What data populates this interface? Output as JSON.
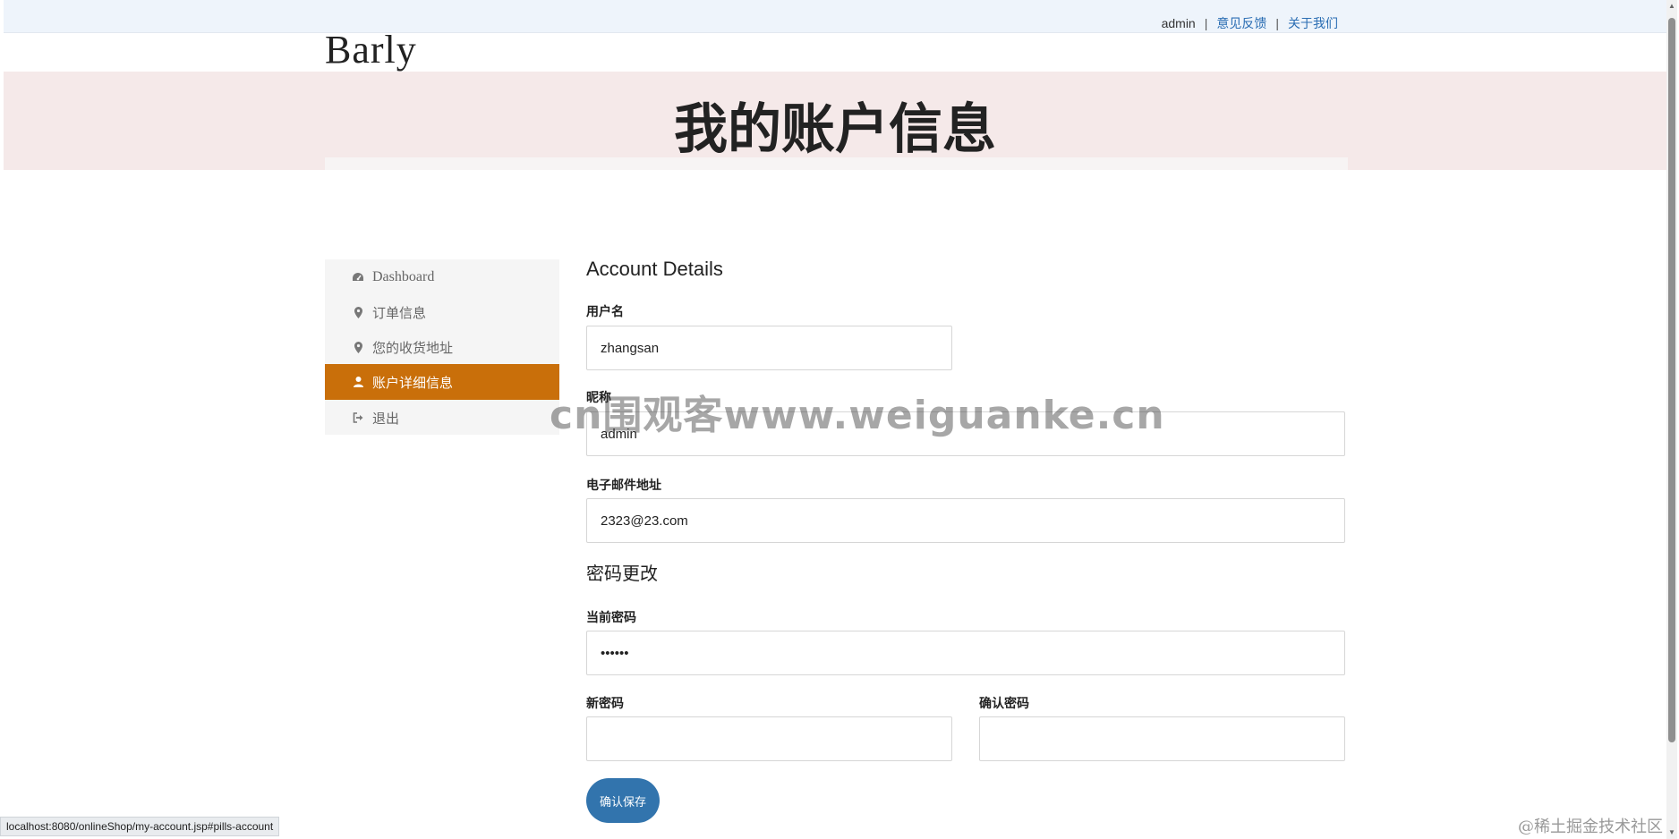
{
  "topnav": {
    "user": "admin",
    "sep1": "|",
    "feedback": "意见反馈",
    "sep2": "|",
    "about": "关于我们"
  },
  "brand": {
    "logo": "Barly"
  },
  "hero": {
    "title": "我的账户信息"
  },
  "sidebar": {
    "items": [
      {
        "label": "Dashboard",
        "icon": "dashboard-icon"
      },
      {
        "label": "订单信息",
        "icon": "map-marker-icon"
      },
      {
        "label": "您的收货地址",
        "icon": "map-marker-icon"
      },
      {
        "label": "账户详细信息",
        "icon": "user-icon",
        "active": true
      },
      {
        "label": "退出",
        "icon": "sign-out-icon"
      }
    ]
  },
  "account": {
    "title": "Account Details",
    "username_label": "用户名",
    "username_value": "zhangsan",
    "nickname_label": "昵称",
    "nickname_value": "admin",
    "email_label": "电子邮件地址",
    "email_value": "2323@23.com",
    "password_section": "密码更改",
    "current_password_label": "当前密码",
    "current_password_value": "••••••",
    "new_password_label": "新密码",
    "new_password_value": "",
    "confirm_password_label": "确认密码",
    "confirm_password_value": "",
    "save_label": "确认保存"
  },
  "overlay": {
    "watermark": "cn围观客www.weiguanke.cn",
    "corner_mark": "@稀土掘金技术社区"
  },
  "statusbar": {
    "url": "localhost:8080/onlineShop/my-account.jsp#pills-account"
  },
  "colors": {
    "accent_active": "#c96f0a",
    "button": "#3274ad",
    "hero_bg": "#f5e9e9",
    "link": "#2a6db3"
  }
}
